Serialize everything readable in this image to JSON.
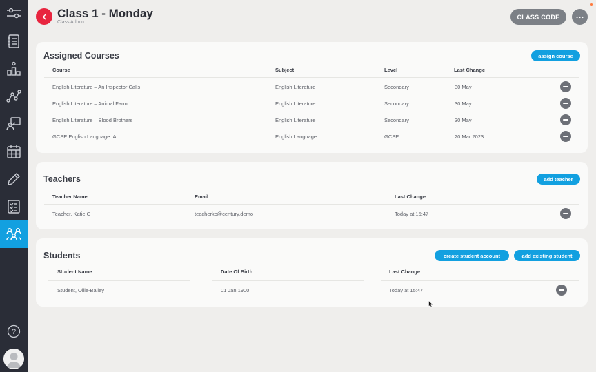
{
  "header": {
    "title": "Class 1 - Monday",
    "subtitle": "Class Admin",
    "class_code_label": "CLASS CODE"
  },
  "sidebar": {
    "items": [
      {
        "icon": "sliders-icon"
      },
      {
        "icon": "notebook-icon"
      },
      {
        "icon": "chart-person-icon"
      },
      {
        "icon": "pathway-icon"
      },
      {
        "icon": "presentation-icon"
      },
      {
        "icon": "calendar-icon"
      },
      {
        "icon": "pencil-icon"
      },
      {
        "icon": "checklist-icon"
      },
      {
        "icon": "group-icon",
        "active": true
      }
    ],
    "help": "?"
  },
  "assigned_courses": {
    "title": "Assigned Courses",
    "action": "assign course",
    "columns": [
      "Course",
      "Subject",
      "Level",
      "Last Change"
    ],
    "rows": [
      [
        "English Literature – An Inspector Calls",
        "English Literature",
        "Secondary",
        "30 May"
      ],
      [
        "English Literature – Animal Farm",
        "English Literature",
        "Secondary",
        "30 May"
      ],
      [
        "English Literature – Blood Brothers",
        "English Literature",
        "Secondary",
        "30 May"
      ],
      [
        "GCSE English Language IA",
        "English Language",
        "GCSE",
        "20 Mar 2023"
      ]
    ]
  },
  "teachers": {
    "title": "Teachers",
    "action": "add teacher",
    "columns": [
      "Teacher Name",
      "Email",
      "Last Change"
    ],
    "rows": [
      [
        "Teacher, Katie C",
        "teacherkc@century.demo",
        "Today at 15:47"
      ]
    ]
  },
  "students": {
    "title": "Students",
    "action_create": "create student account",
    "action_add": "add existing student",
    "columns": [
      "Student Name",
      "Date Of Birth",
      "Last Change"
    ],
    "rows": [
      [
        "Student, Ollie-Bailey",
        "01 Jan 1900",
        "Today at 15:47"
      ]
    ]
  },
  "colors": {
    "accent": "#12a0e0",
    "back": "#e8253f",
    "sidebar": "#2a2d37",
    "grey_button": "#7c8086"
  }
}
